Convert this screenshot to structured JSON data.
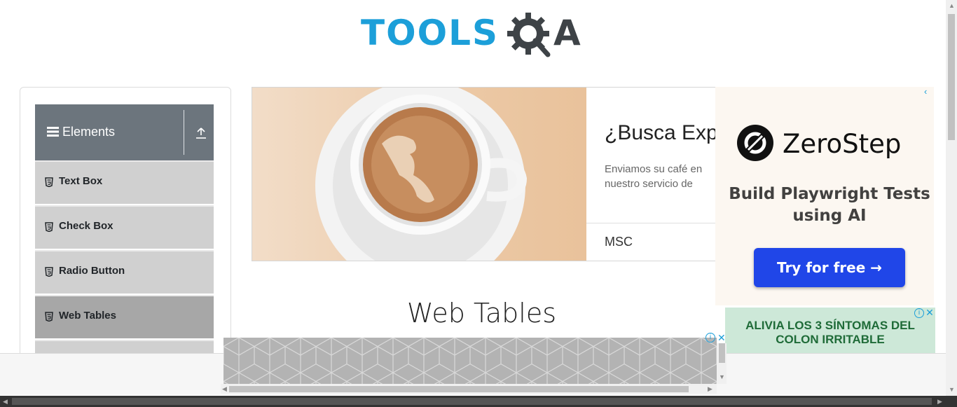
{
  "logo": {
    "tools_text": "TOOLS",
    "a_text": "A"
  },
  "sidebar": {
    "group_title": "Elements",
    "items": [
      {
        "label": "Text Box"
      },
      {
        "label": "Check Box"
      },
      {
        "label": "Radio Button"
      },
      {
        "label": "Web Tables",
        "active": true
      }
    ]
  },
  "coffee_ad": {
    "headline": "¿Busca Expo",
    "description": "Enviamos su café en nuestro servicio de",
    "brand": "MSC"
  },
  "zerostep_ad": {
    "brand": "ZeroStep",
    "tagline": "Build Playwright Tests using AI",
    "cta": "Try for free →"
  },
  "colon_ad": {
    "text": "ALIVIA LOS 3  SÍNTOMAS DEL COLON IRRITABLE"
  },
  "main": {
    "heading": "Web Tables"
  },
  "colors": {
    "brand_blue": "#1c9fd9",
    "sidebar_header": "#6c757d",
    "cta_blue": "#2046e8",
    "colon_green": "#1f6b38"
  }
}
